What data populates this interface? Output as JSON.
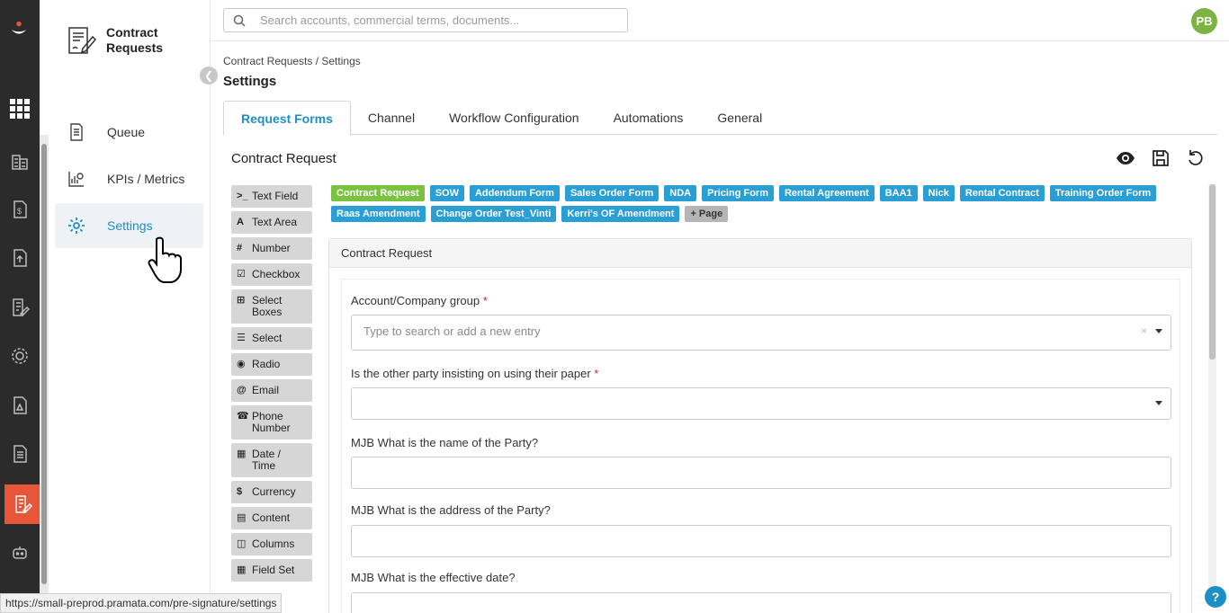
{
  "app": {
    "title": "Contract Requests"
  },
  "search": {
    "placeholder": "Search accounts, commercial terms, documents..."
  },
  "user": {
    "initials": "PB"
  },
  "sidebar": {
    "items": [
      {
        "label": "Queue",
        "icon": "document-icon"
      },
      {
        "label": "KPIs / Metrics",
        "icon": "chart-icon"
      },
      {
        "label": "Settings",
        "icon": "gear-icon",
        "active": true
      }
    ]
  },
  "breadcrumb": "Contract Requests / Settings",
  "page_title": "Settings",
  "tabs": [
    {
      "label": "Request Forms",
      "active": true
    },
    {
      "label": "Channel"
    },
    {
      "label": "Workflow Configuration"
    },
    {
      "label": "Automations"
    },
    {
      "label": "General"
    }
  ],
  "section_title": "Contract Request",
  "palette": [
    {
      "icon": ">_",
      "label": "Text Field"
    },
    {
      "icon": "A",
      "label": "Text Area"
    },
    {
      "icon": "#",
      "label": "Number"
    },
    {
      "icon": "☑",
      "label": "Checkbox"
    },
    {
      "icon": "⊞",
      "label": "Select Boxes"
    },
    {
      "icon": "☰",
      "label": "Select"
    },
    {
      "icon": "◉",
      "label": "Radio"
    },
    {
      "icon": "@",
      "label": "Email"
    },
    {
      "icon": "☎",
      "label": "Phone Number"
    },
    {
      "icon": "▦",
      "label": "Date / Time"
    },
    {
      "icon": "$",
      "label": "Currency"
    },
    {
      "icon": "▤",
      "label": "Content"
    },
    {
      "icon": "◫",
      "label": "Columns"
    },
    {
      "icon": "▦",
      "label": "Field Set"
    }
  ],
  "forms": [
    {
      "label": "Contract Request",
      "color": "#7cc242",
      "active": true
    },
    {
      "label": "SOW"
    },
    {
      "label": "Addendum Form"
    },
    {
      "label": "Sales Order Form"
    },
    {
      "label": "NDA"
    },
    {
      "label": "Pricing Form"
    },
    {
      "label": "Rental Agreement"
    },
    {
      "label": "BAA1"
    },
    {
      "label": "Nick"
    },
    {
      "label": "Rental Contract"
    },
    {
      "label": "Training Order Form"
    },
    {
      "label": "Raas Amendment"
    },
    {
      "label": "Change Order Test_Vinti"
    },
    {
      "label": "Kerri's OF Amendment"
    }
  ],
  "add_page_label": "+ Page",
  "card": {
    "title": "Contract Request",
    "fields": [
      {
        "label": "Account/Company group",
        "required": true,
        "placeholder": "Type to search or add a new entry"
      },
      {
        "label": "Is the other party insisting on using their paper",
        "required": true
      },
      {
        "label": "MJB What is the name of the Party?"
      },
      {
        "label": "MJB What is the address of the Party?"
      },
      {
        "label": "MJB What is the effective date?"
      }
    ],
    "required_mark": "*",
    "clear_mark": "×"
  },
  "status_url": "https://small-preprod.pramata.com/pre-signature/settings",
  "help_label": "?",
  "colors": {
    "accent": "#1e8fc6",
    "active_rail": "#e8563a",
    "form_pill": "#2a9fd6",
    "active_pill": "#7cc242"
  }
}
